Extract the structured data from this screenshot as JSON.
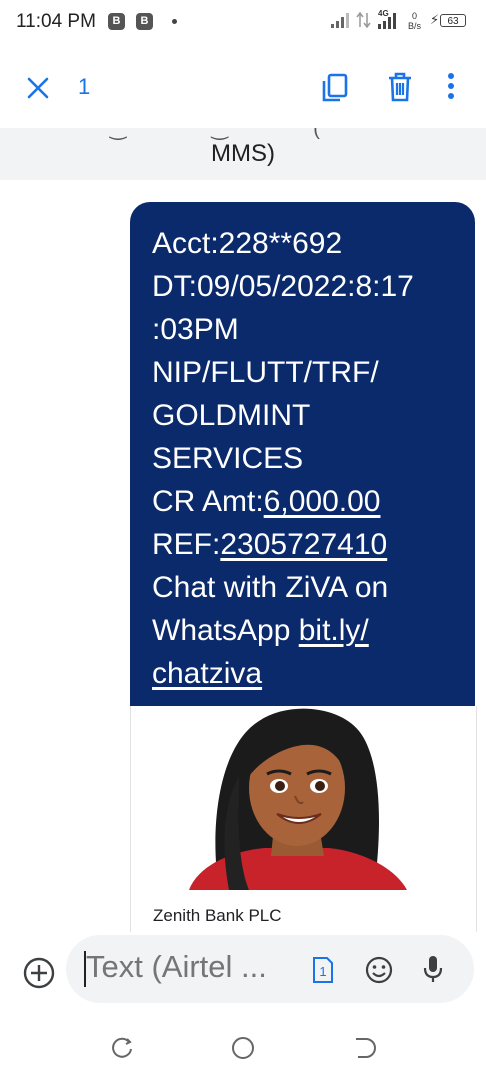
{
  "status_bar": {
    "time": "11:04 PM",
    "badge1": "B",
    "badge2": "B",
    "network": "4G",
    "speed_value": "0",
    "speed_unit": "B/s",
    "battery": "63"
  },
  "toolbar": {
    "selected_count": "1",
    "icons": [
      "close-icon",
      "copy-icon",
      "delete-icon",
      "more-vert-icon"
    ],
    "accent_color": "#1a73e8"
  },
  "previous_message": {
    "text": "MMS)"
  },
  "message": {
    "bubble_color": "#0b2a6b",
    "acct": "Acct:228**692",
    "dt1": "DT:09/05/2022:8:17",
    "dt2": ":03PM",
    "narration1": "NIP/FLUTT/TRF/",
    "narration2": "GOLDMINT",
    "narration3": "SERVICES",
    "amt_prefix": "CR Amt:",
    "amt_value": "6,000.00",
    "ref_prefix": "REF:",
    "ref_value": "2305727410",
    "chat1": "Chat with ZiVA on",
    "chat2_prefix": "WhatsApp ",
    "chat2_link": "bit.ly/",
    "chat3_link": "chatziva"
  },
  "attachment": {
    "sender": "Zenith Bank PLC"
  },
  "compose": {
    "placeholder": "Text (Airtel ...",
    "sim_label": "1"
  },
  "nav": {
    "icons": [
      "recent-apps-icon",
      "home-icon",
      "back-icon"
    ]
  }
}
